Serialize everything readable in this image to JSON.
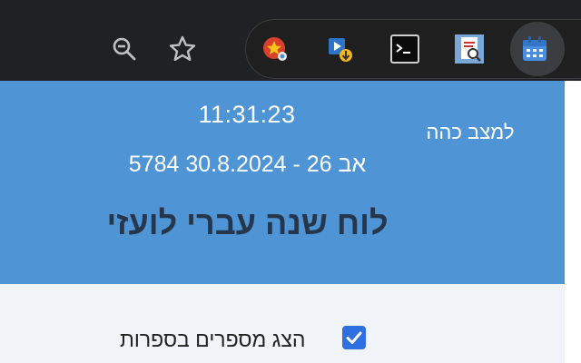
{
  "browser": {
    "toolbar_icons": [
      "zoom-out-icon",
      "bookmark-star-icon"
    ],
    "extensions": [
      "badge-star-extension-icon",
      "video-download-extension-icon",
      "terminal-extension-icon",
      "document-search-extension-icon",
      "calendar-extension-icon"
    ],
    "colors": {
      "toolbar_bg": "#202124",
      "accent": "#4f95d5",
      "checkbox": "#2f6fe0"
    }
  },
  "popup": {
    "time": "11:31:23",
    "date": "5784 אב 26 - 30.8.2024",
    "mode_link": "למצב כהה",
    "title": "לוח שנה עברי לועזי",
    "options": [
      {
        "label": "הצג מספרים בספרות",
        "checked": true
      }
    ]
  }
}
